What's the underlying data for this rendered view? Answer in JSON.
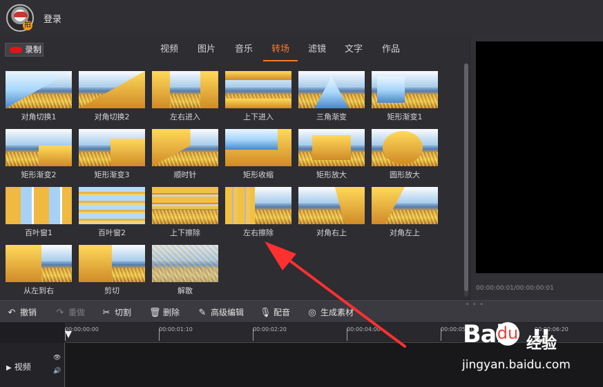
{
  "top": {
    "login": "登录"
  },
  "toolbar_left": {
    "record_label": "录制"
  },
  "tabs": [
    {
      "label": "视频",
      "active": false
    },
    {
      "label": "图片",
      "active": false
    },
    {
      "label": "音乐",
      "active": false
    },
    {
      "label": "转场",
      "active": true
    },
    {
      "label": "滤镜",
      "active": false
    },
    {
      "label": "文字",
      "active": false
    },
    {
      "label": "作品",
      "active": false
    }
  ],
  "transitions": [
    "对角切换1",
    "对角切换2",
    "左右进入",
    "上下进入",
    "三角渐变",
    "矩形渐变1",
    "矩形渐变2",
    "矩形渐变3",
    "顺时针",
    "矩形收缩",
    "矩形放大",
    "圆形放大",
    "百叶窗1",
    "百叶窗2",
    "上下擦除",
    "左右擦除",
    "对角右上",
    "对角左上",
    "从左到右",
    "剪切",
    "解散"
  ],
  "preview": {
    "timecode": "00:00:00:01/00:00:00:01"
  },
  "edit_toolbar": {
    "undo": "撤销",
    "redo": "重做",
    "cut": "切割",
    "delete": "删除",
    "advanced_edit": "高级编辑",
    "dub": "配音",
    "generate": "生成素材"
  },
  "timeline": {
    "ticks": [
      "00:00:00:00",
      "00:00:01:10",
      "00:00:02:20",
      "00:00:04:00",
      "00:00:05:10",
      "00:00:06:20"
    ],
    "track_label": "视频"
  },
  "watermark": {
    "brand": "Bai",
    "brand_tail": "u",
    "paw": "du",
    "cn": "经验",
    "url": "jingyan.baidu.com"
  },
  "colors": {
    "accent": "#ff7a29",
    "record": "#e01515",
    "annotation_arrow": "#ff3030"
  }
}
